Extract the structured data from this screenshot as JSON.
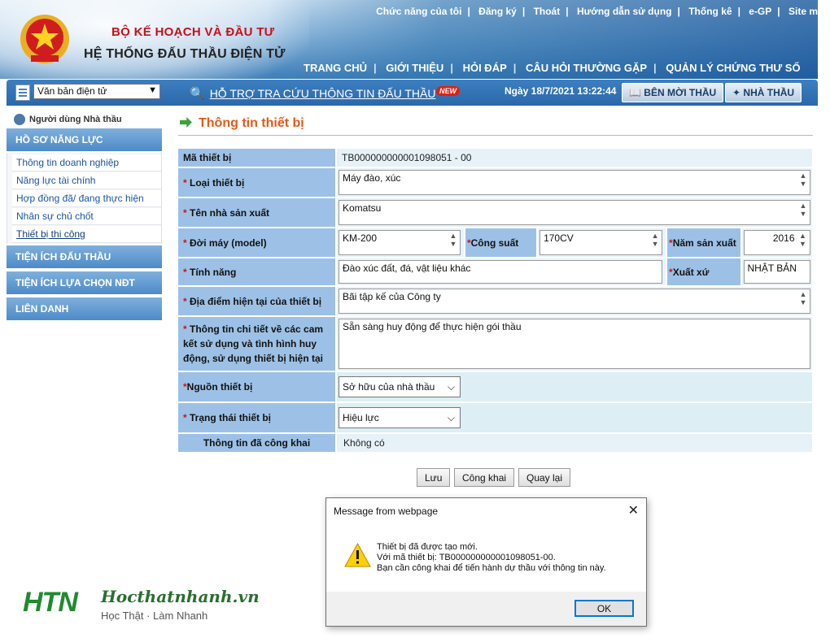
{
  "header": {
    "ministry": "BỘ KẾ HOẠCH VÀ ĐẦU TƯ",
    "system_name": "HỆ THỐNG ĐẤU THẦU ĐIỆN TỬ",
    "top_links": [
      "Chức năng của tôi",
      "Đăng ký",
      "Thoát",
      "Hướng dẫn sử dụng",
      "Thống kê",
      "e-GP",
      "Site m"
    ],
    "main_nav": [
      "TRANG CHỦ",
      "GIỚI THIỆU",
      "HỎI ĐÁP",
      "CÂU HỎI THƯỜNG GẶP",
      "QUẢN LÝ CHỨNG THƯ SỐ"
    ]
  },
  "subbar": {
    "doc_select": "Văn bản điện tử",
    "support_link": "HỖ TRỢ TRA CỨU THÔNG TIN ĐẤU THẦU",
    "new_badge": "NEW",
    "datetime": "Ngày 18/7/2021 13:22:44",
    "btn_moithau": "BÊN MỜI THẦU",
    "btn_nhathau": "NHÀ THẦU"
  },
  "sidebar": {
    "user": "Người dùng Nhà thầu",
    "section_profile": "HỒ SƠ NĂNG LỰC",
    "items": [
      "Thông tin doanh nghiệp",
      "Năng lực tài chính",
      "Hợp đồng đã/ đang thực hiện",
      "Nhân sự chủ chốt",
      "Thiết bị thi công"
    ],
    "section_utils": "TIỆN ÍCH ĐẤU THẦU",
    "section_ndt": "TIỆN ÍCH LỰA CHỌN NĐT",
    "section_lienDanh": "LIÊN DANH"
  },
  "page": {
    "title": "Thông tin thiết bị"
  },
  "form": {
    "ma_thiet_bi_label": "Mã thiết bị",
    "ma_thiet_bi_value": "TB000000000001098051 - 00",
    "loai_label": "Loại thiết bị",
    "loai_value": "Máy đào, xúc",
    "nsx_label": "Tên nhà sản xuất",
    "nsx_value": "Komatsu",
    "model_label": "Đời máy (model)",
    "model_value": "KM-200",
    "cong_suat_label": "Công suất",
    "cong_suat_value": "170CV",
    "nam_sx_label": "Năm sản xuất",
    "nam_sx_value": "2016",
    "tinh_nang_label": "Tính năng",
    "tinh_nang_value": "Đào xúc đất, đá, vật liệu khác",
    "xuat_xu_label": "Xuất xứ",
    "xuat_xu_value": "NHẬT BẢN",
    "dia_diem_label": "Địa điểm hiện tại của thiết bị",
    "dia_diem_value": "Bãi tập kế của Công ty",
    "chi_tiet_label": "Thông tin chi tiết về các cam kết sử dụng và tình hình huy động, sử dụng thiết bị hiện tại",
    "chi_tiet_value": "Sẵn sàng huy động để thực hiện gói thầu",
    "nguon_label": "Nguồn thiết bị",
    "nguon_value": "Sở hữu của nhà thầu",
    "trang_thai_label": "Trạng thái thiết bị",
    "trang_thai_value": "Hiệu lực",
    "cong_khai_label": "Thông tin đã công khai",
    "cong_khai_value": "Không có",
    "required_mark": "*"
  },
  "buttons": {
    "save": "Lưu",
    "publish": "Công khai",
    "back": "Quay lại"
  },
  "dialog": {
    "title": "Message from webpage",
    "line1": "Thiết bị đã được tạo mới.",
    "line2": "Với mã thiết bị: TB000000000001098051-00.",
    "line3": "Bạn cần công khai để tiến hành dự thầu với thông tin này.",
    "ok": "OK"
  },
  "watermark": {
    "logo": "HTN",
    "site": "Hocthatnhanh.vn",
    "tagline": "Học Thật · Làm Nhanh"
  }
}
